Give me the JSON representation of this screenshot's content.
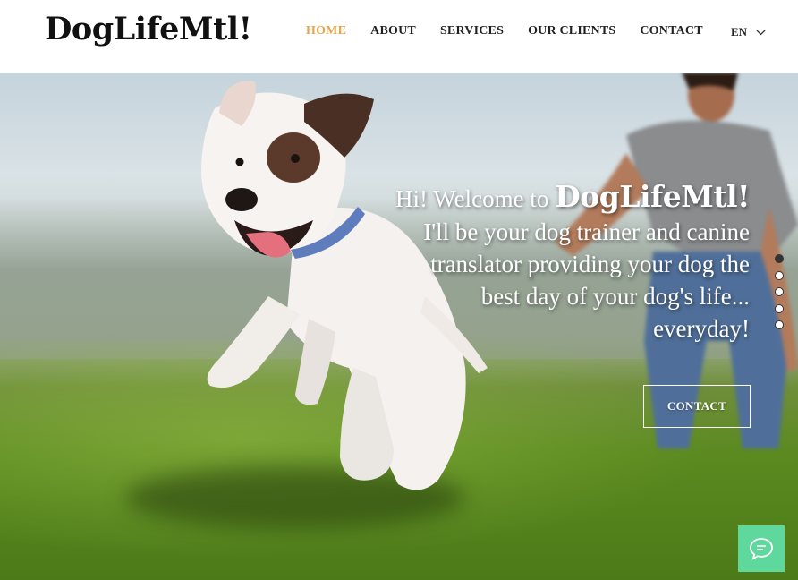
{
  "header": {
    "logo": "DogLifeMtl!",
    "nav": [
      {
        "label": "HOME",
        "active": true
      },
      {
        "label": "ABOUT",
        "active": false
      },
      {
        "label": "SERVICES",
        "active": false
      },
      {
        "label": "OUR CLIENTS",
        "active": false
      },
      {
        "label": "CONTACT",
        "active": false
      }
    ],
    "language": "EN"
  },
  "hero": {
    "greeting": "Hi! Welcome to",
    "brand": "DogLifeMtl!",
    "body": "I'll be your dog trainer and canine translator providing your dog the best day of your dog's life... everyday!",
    "body_lines": [
      "I'll be your dog trainer and canine",
      "translator providing your dog the",
      "best day of your dog's life...",
      "everyday!"
    ],
    "cta_label": "CONTACT"
  },
  "section_dots": {
    "count": 5,
    "active_index": 0
  },
  "colors": {
    "accent": "#e6a44c",
    "chat": "#5ed89c",
    "text": "#222222"
  },
  "icons": {
    "chat": "chat-bubble-icon",
    "language_dropdown": "chevron-down-icon"
  }
}
